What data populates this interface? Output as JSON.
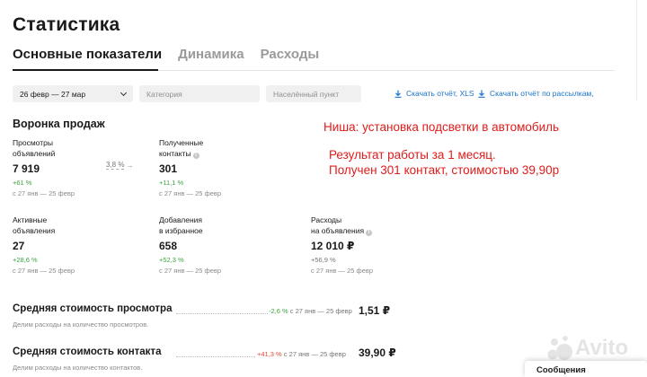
{
  "page": {
    "title": "Статистика"
  },
  "tabs": [
    {
      "label": "Основные показатели",
      "active": true
    },
    {
      "label": "Динамика",
      "active": false
    },
    {
      "label": "Расходы",
      "active": false
    }
  ],
  "filters": {
    "date_range": "26 февр — 27 мар",
    "category_placeholder": "Категория",
    "city_placeholder": "Населённый пункт"
  },
  "downloads": {
    "xls_label": "Скачать отчёт, XLS",
    "mailing_label": "Скачать отчёт по рассылкам,"
  },
  "funnel": {
    "title": "Воронка продаж",
    "conversion": "3,8 %",
    "metrics": {
      "views": {
        "label_1": "Просмотры",
        "label_2": "объявлений",
        "value": "7 919",
        "delta": "+61 %",
        "period": "с 27 янв — 25 февр"
      },
      "contacts": {
        "label_1": "Полученные",
        "label_2": "контакты",
        "value": "301",
        "delta": "+11,1 %",
        "period": "с 27 янв — 25 февр"
      },
      "active_ads": {
        "label_1": "Активные",
        "label_2": "объявления",
        "value": "27",
        "delta": "+28,6 %",
        "period": "с 27 янв — 25 февр"
      },
      "favorites": {
        "label_1": "Добавления",
        "label_2": "в избранное",
        "value": "658",
        "delta": "+52,3 %",
        "period": "с 27 янв — 25 февр"
      },
      "expenses": {
        "label_1": "Расходы",
        "label_2": "на объявления",
        "value": "12 010 ₽",
        "delta": "+56,9 %",
        "period": "с 27 янв — 25 февр"
      }
    }
  },
  "annotation": {
    "line_1": "Ниша: установка подсветки в автомобиль",
    "line_2": "Результат работы за 1 месяц.",
    "line_3": "Получен 301 контакт, стоимостью 39,90р"
  },
  "cost_rows": [
    {
      "title": "Средняя стоимость просмотра",
      "delta": "-2,6 %",
      "delta_color": "green",
      "period": "с 27 янв — 25 февр",
      "value": "1,51 ₽",
      "subtitle": "Делим расходы на количество просмотров."
    },
    {
      "title": "Средняя стоимость контакта",
      "delta": "+41,3 %",
      "delta_color": "red",
      "period": "с 27 янв — 25 февр",
      "value": "39,90 ₽",
      "subtitle": "Делим расходы на количество контактов."
    }
  ],
  "watermark": {
    "brand": "Avito"
  },
  "messages_widget": {
    "label": "Сообщения"
  },
  "colors": {
    "link_blue": "#1a73c8",
    "delta_green": "#3ba340",
    "delta_red": "#e04a3a",
    "annotation_red": "#e11b1b"
  }
}
